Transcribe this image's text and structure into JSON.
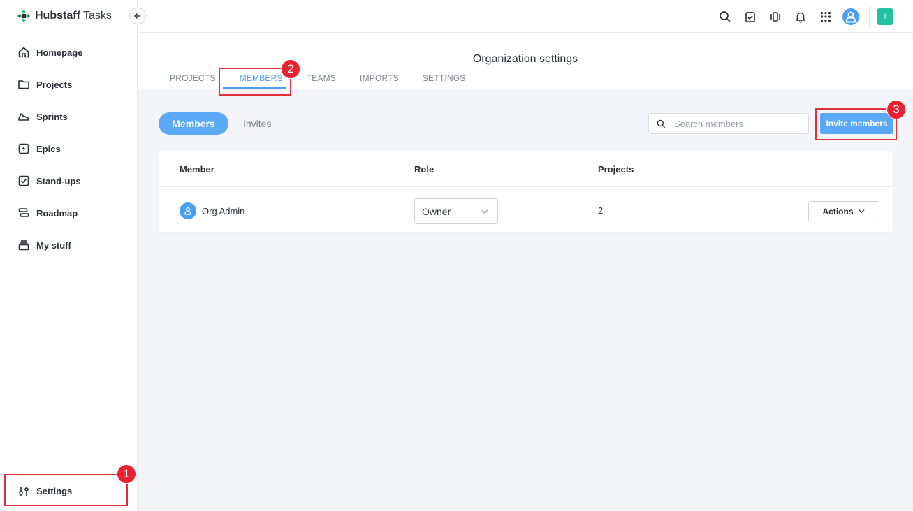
{
  "brand": {
    "name_bold": "Hubstaff",
    "name_rest": " Tasks"
  },
  "sidebar": {
    "items": [
      {
        "label": "Homepage",
        "icon": "home-icon"
      },
      {
        "label": "Projects",
        "icon": "folder-icon"
      },
      {
        "label": "Sprints",
        "icon": "sneaker-icon"
      },
      {
        "label": "Epics",
        "icon": "lightning-icon"
      },
      {
        "label": "Stand-ups",
        "icon": "checkbox-icon"
      },
      {
        "label": "Roadmap",
        "icon": "roadmap-icon"
      },
      {
        "label": "My stuff",
        "icon": "stack-icon"
      }
    ],
    "settings_label": "Settings"
  },
  "topbar": {
    "org_initial": "I"
  },
  "header": {
    "title": "Organization settings",
    "tabs": [
      {
        "label": "PROJECTS"
      },
      {
        "label": "MEMBERS"
      },
      {
        "label": "TEAMS"
      },
      {
        "label": "IMPORTS"
      },
      {
        "label": "SETTINGS"
      }
    ],
    "active_tab": "MEMBERS"
  },
  "main": {
    "segments": {
      "members": "Members",
      "invites": "Invites"
    },
    "search": {
      "placeholder": "Search members",
      "value": ""
    },
    "invite_button": "Invite members",
    "table": {
      "columns": {
        "member": "Member",
        "role": "Role",
        "projects": "Projects"
      },
      "rows": [
        {
          "member": "Org Admin",
          "role": "Owner",
          "projects": "2",
          "actions": "Actions"
        }
      ]
    }
  },
  "annotations": {
    "badge1": "1",
    "badge2": "2",
    "badge3": "3"
  },
  "colors": {
    "accent": "#4a9ff5",
    "highlight": "#e0303c",
    "org_badge": "#22c2a0"
  }
}
